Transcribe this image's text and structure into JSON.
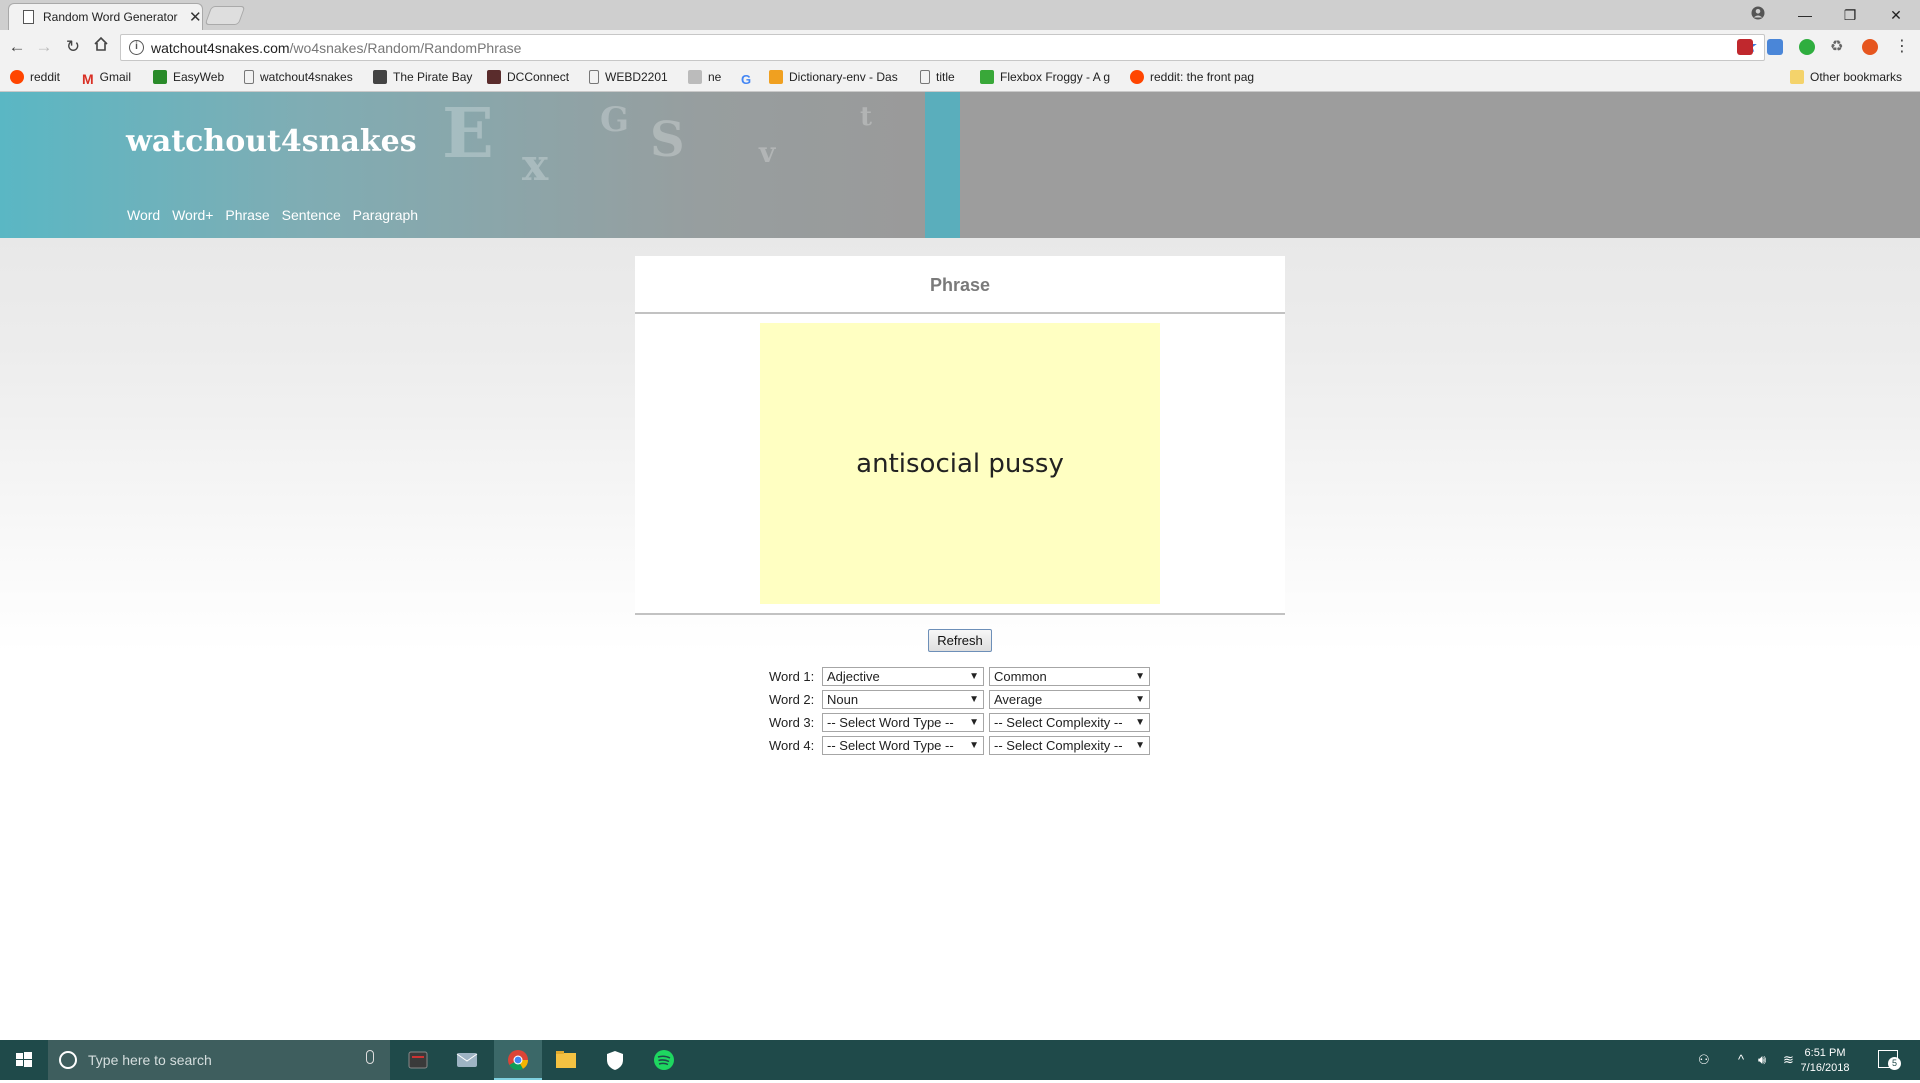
{
  "browser": {
    "tab_title": "Random Word Generator",
    "tab_close": "✕",
    "url_host": "watchout4snakes.com",
    "url_path": "/wo4snakes/Random/RandomPhrase"
  },
  "bookmarks": [
    {
      "label": "reddit",
      "color": "#ff4500"
    },
    {
      "label": "Gmail",
      "color": "#d93025"
    },
    {
      "label": "EasyWeb",
      "color": "#2a8b2a"
    },
    {
      "label": "watchout4snakes",
      "color": "#888888"
    },
    {
      "label": "The Pirate Bay",
      "color": "#444444"
    },
    {
      "label": "DCConnect",
      "color": "#5a2c2c"
    },
    {
      "label": "WEBD2201",
      "color": "#888888"
    },
    {
      "label": "ne",
      "color": "#aaaaaa"
    },
    {
      "label": "",
      "color": "#4285f4"
    },
    {
      "label": "Dictionary-env - Das",
      "color": "#f0a020"
    },
    {
      "label": "title",
      "color": "#888888"
    },
    {
      "label": "Flexbox Froggy - A g",
      "color": "#39a839"
    },
    {
      "label": "reddit: the front pag",
      "color": "#ff4500"
    }
  ],
  "other_bookmarks": "Other bookmarks",
  "site": {
    "title": "watchout4snakes",
    "nav": [
      "Word",
      "Word+",
      "Phrase",
      "Sentence",
      "Paragraph"
    ],
    "decorative_letters": [
      "E",
      "x",
      "G",
      "S",
      "v",
      "t"
    ]
  },
  "card": {
    "heading": "Phrase",
    "phrase": "antisocial pussy"
  },
  "refresh_label": "Refresh",
  "word_rows": [
    {
      "label": "Word 1:",
      "type": "Adjective",
      "complexity": "Common"
    },
    {
      "label": "Word 2:",
      "type": "Noun",
      "complexity": "Average"
    },
    {
      "label": "Word 3:",
      "type": "-- Select Word Type --",
      "complexity": "-- Select Complexity --"
    },
    {
      "label": "Word 4:",
      "type": "-- Select Word Type --",
      "complexity": "-- Select Complexity --"
    }
  ],
  "taskbar": {
    "search_placeholder": "Type here to search",
    "time": "6:51 PM",
    "date": "7/16/2018",
    "notification_count": "5"
  },
  "colors": {
    "header_teal": "#5ab7c4",
    "phrase_bg": "#ffffc2",
    "taskbar": "#1f4a4a"
  }
}
